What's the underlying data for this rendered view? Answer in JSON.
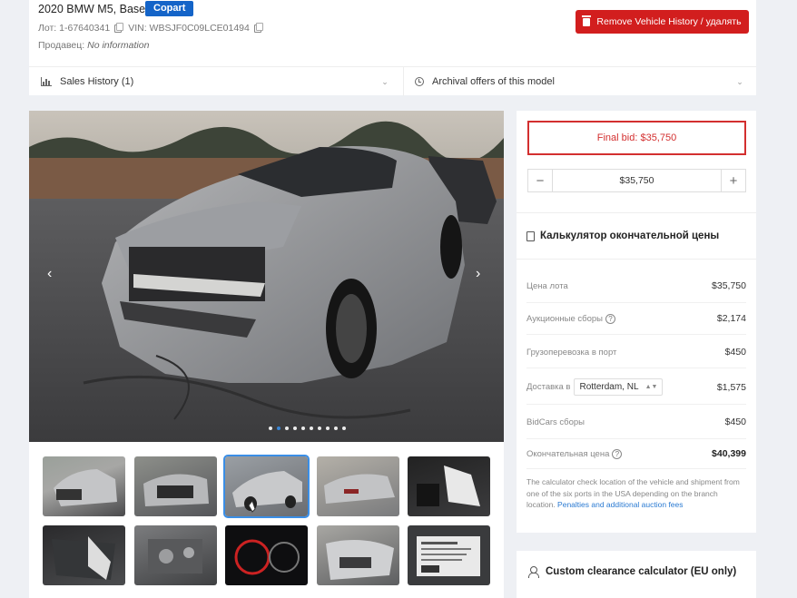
{
  "header": {
    "title": "2020 BMW M5, Base",
    "auction_badge": "Copart",
    "lot_label": "Лот: 1-67640341",
    "vin_label": "VIN: WBSJF0C09LCE01494",
    "seller_label": "Продавец:",
    "seller_value": "No information",
    "remove_button": "Remove Vehicle History / удалять"
  },
  "tabs": {
    "sales_history": "Sales History (1)",
    "archival": "Archival offers of this model"
  },
  "gallery": {
    "photo_count": 10,
    "active_photo_index": 1,
    "thumbnails": [
      "thumb-front-left",
      "thumb-front-damage",
      "thumb-rear-left",
      "thumb-rear-right",
      "thumb-interior-airbag",
      "thumb-interior-door",
      "thumb-engine-bay",
      "thumb-instrument-cluster",
      "thumb-front-close",
      "thumb-label-sticker"
    ],
    "active_thumbnail_index": 2
  },
  "bid": {
    "final_bid": "Final bid: $35,750",
    "stepper_value": "$35,750",
    "minus": "−",
    "plus": "+"
  },
  "calculator": {
    "title": "Калькулятор окончательной цены",
    "rows": [
      {
        "label": "Цена лота",
        "value": "$35,750"
      },
      {
        "label": "Аукционные сборы",
        "value": "$2,174"
      },
      {
        "label": "Грузоперевозка в порт",
        "value": "$450"
      },
      {
        "label": "Доставка в",
        "value": "$1,575"
      },
      {
        "label": "BidCars сборы",
        "value": "$450"
      },
      {
        "label": "Окончательная цена",
        "value": "$40,399"
      }
    ],
    "destination_select": "Rotterdam, NL",
    "help_glyph": "?",
    "note": "The calculator check location of the vehicle and shipment from one of the six ports in the USA depending on the branch location.",
    "note_link": "Penalties and additional auction fees"
  },
  "customs": {
    "title": "Custom clearance calculator (EU only)"
  },
  "colors": {
    "accent_blue": "#1464c8",
    "danger_red": "#d21e1e",
    "final_bid_red": "#d32f2f",
    "link_blue": "#2a7ad2"
  }
}
